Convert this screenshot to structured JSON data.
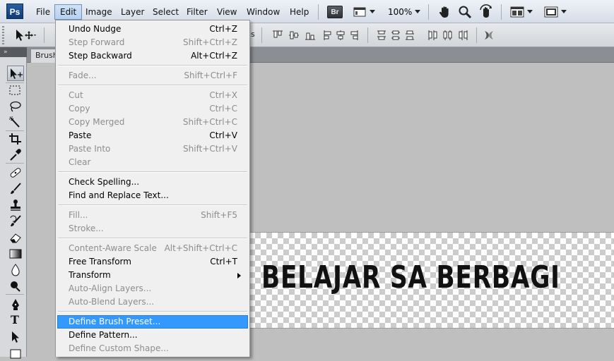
{
  "app": {
    "logo": "Ps"
  },
  "menubar": {
    "items": [
      {
        "label": "File"
      },
      {
        "label": "Edit"
      },
      {
        "label": "Image"
      },
      {
        "label": "Layer"
      },
      {
        "label": "Select"
      },
      {
        "label": "Filter"
      },
      {
        "label": "View"
      },
      {
        "label": "Window"
      },
      {
        "label": "Help"
      }
    ],
    "bridge_label": "Br",
    "zoom": "100%",
    "icons": [
      "bridge-icon",
      "screen-mode-icon",
      "hand-icon",
      "zoom-icon",
      "rotate-view-icon",
      "arrange-documents-icon",
      "screen-mode-icon"
    ]
  },
  "options_bar": {
    "partial_label": "ls",
    "icons": [
      "move-tool-icon",
      "align-top-icon",
      "align-vcenter-icon",
      "align-bottom-icon",
      "align-left-icon",
      "align-hcenter-icon",
      "align-right-icon",
      "distribute-top-icon",
      "distribute-vcenter-icon",
      "distribute-bottom-icon",
      "distribute-left-icon",
      "distribute-hcenter-icon",
      "distribute-right-icon",
      "auto-align-icon"
    ]
  },
  "document": {
    "tab_title": "Brush",
    "canvas_text": "BELAJAR SA BERBAGI"
  },
  "tools": [
    "move-tool",
    "marquee-tool",
    "lasso-tool",
    "quick-selection-tool",
    "crop-tool",
    "eyedropper-tool",
    "healing-brush-tool",
    "brush-tool",
    "clone-stamp-tool",
    "history-brush-tool",
    "eraser-tool",
    "gradient-tool",
    "blur-tool",
    "dodge-tool",
    "pen-tool",
    "type-tool",
    "path-selection-tool",
    "shape-tool"
  ],
  "edit_menu": {
    "items": [
      {
        "label": "Undo Nudge",
        "shortcut": "Ctrl+Z",
        "enabled": true
      },
      {
        "label": "Step Forward",
        "shortcut": "Shift+Ctrl+Z",
        "enabled": false
      },
      {
        "label": "Step Backward",
        "shortcut": "Alt+Ctrl+Z",
        "enabled": true
      },
      {
        "label": "Fade...",
        "shortcut": "Shift+Ctrl+F",
        "enabled": false
      },
      {
        "label": "Cut",
        "shortcut": "Ctrl+X",
        "enabled": false
      },
      {
        "label": "Copy",
        "shortcut": "Ctrl+C",
        "enabled": false
      },
      {
        "label": "Copy Merged",
        "shortcut": "Shift+Ctrl+C",
        "enabled": false
      },
      {
        "label": "Paste",
        "shortcut": "Ctrl+V",
        "enabled": true
      },
      {
        "label": "Paste Into",
        "shortcut": "Shift+Ctrl+V",
        "enabled": false
      },
      {
        "label": "Clear",
        "shortcut": "",
        "enabled": false
      },
      {
        "label": "Check Spelling...",
        "shortcut": "",
        "enabled": true
      },
      {
        "label": "Find and Replace Text...",
        "shortcut": "",
        "enabled": true
      },
      {
        "label": "Fill...",
        "shortcut": "Shift+F5",
        "enabled": false
      },
      {
        "label": "Stroke...",
        "shortcut": "",
        "enabled": false
      },
      {
        "label": "Content-Aware Scale",
        "shortcut": "Alt+Shift+Ctrl+C",
        "enabled": false
      },
      {
        "label": "Free Transform",
        "shortcut": "Ctrl+T",
        "enabled": true
      },
      {
        "label": "Transform",
        "shortcut": "",
        "enabled": true,
        "submenu": true
      },
      {
        "label": "Auto-Align Layers...",
        "shortcut": "",
        "enabled": false
      },
      {
        "label": "Auto-Blend Layers...",
        "shortcut": "",
        "enabled": false
      },
      {
        "label": "Define Brush Preset...",
        "shortcut": "",
        "enabled": true,
        "highlighted": true
      },
      {
        "label": "Define Pattern...",
        "shortcut": "",
        "enabled": true
      },
      {
        "label": "Define Custom Shape...",
        "shortcut": "",
        "enabled": false
      }
    ]
  },
  "colors": {
    "highlight": "#3399ff",
    "disabled_text": "#8d8d8d",
    "canvas_text": "#111111"
  }
}
